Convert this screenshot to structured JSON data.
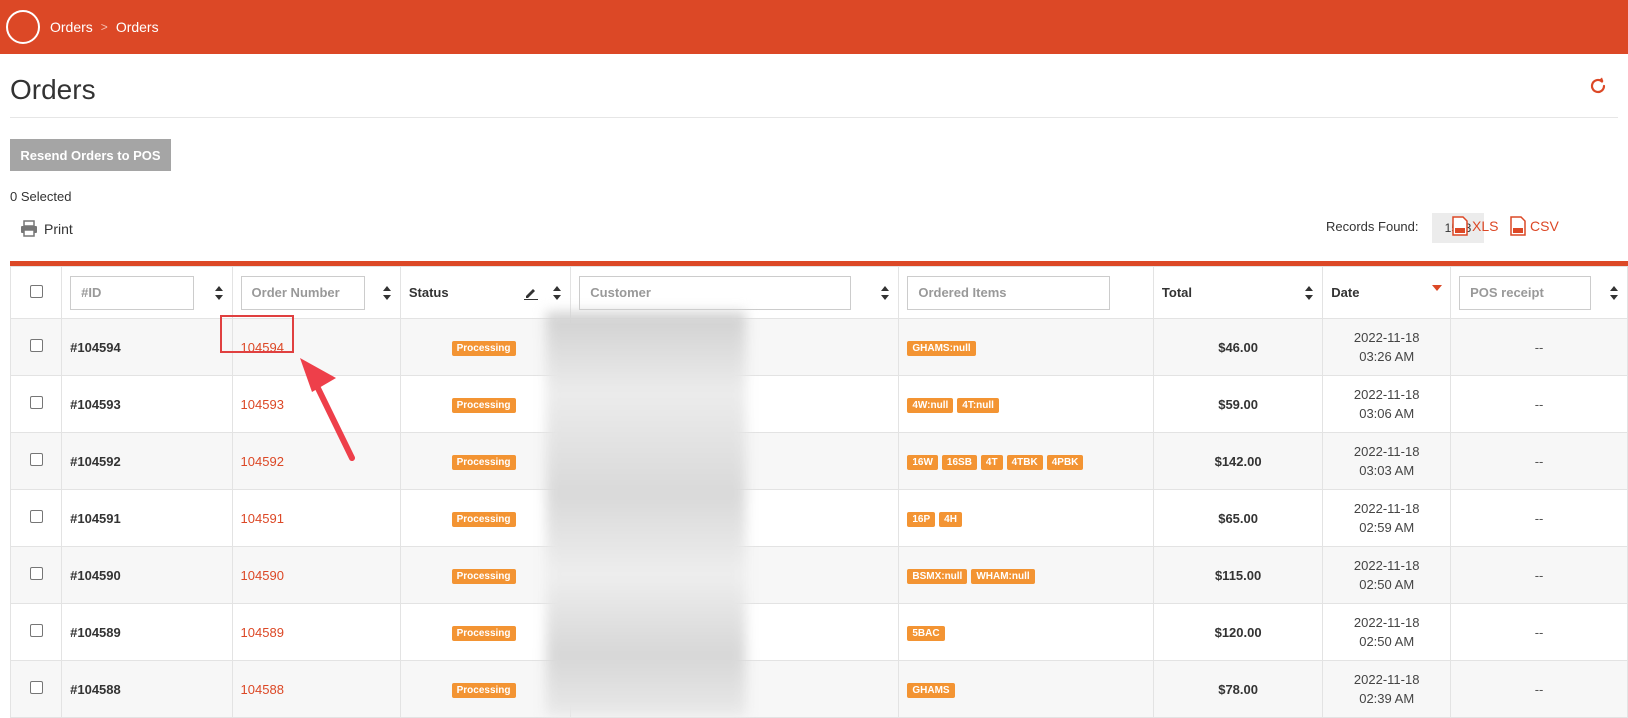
{
  "breadcrumb": {
    "items": [
      "Orders",
      "Orders"
    ],
    "separator": ">"
  },
  "page": {
    "title": "Orders"
  },
  "actions": {
    "resend_label": "Resend Orders to POS",
    "selected_text": "0 Selected",
    "print_label": "Print",
    "records_label": "Records Found:",
    "records_count": "1543",
    "xls_label": "XLS",
    "csv_label": "CSV"
  },
  "table": {
    "headers": {
      "id_placeholder": "#ID",
      "order_number_placeholder": "Order Number",
      "status": "Status",
      "customer_placeholder": "Customer",
      "ordered_items_placeholder": "Ordered Items",
      "total": "Total",
      "date": "Date",
      "pos_receipt_placeholder": "POS receipt"
    },
    "rows": [
      {
        "id": "#104594",
        "order_number": "104594",
        "status": "Processing",
        "items": [
          "GHAMS:null"
        ],
        "total": "$46.00",
        "date": "2022-11-18",
        "time": "03:26 AM",
        "pos": "--"
      },
      {
        "id": "#104593",
        "order_number": "104593",
        "status": "Processing",
        "items": [
          "4W:null",
          "4T:null"
        ],
        "total": "$59.00",
        "date": "2022-11-18",
        "time": "03:06 AM",
        "pos": "--"
      },
      {
        "id": "#104592",
        "order_number": "104592",
        "status": "Processing",
        "items": [
          "16W",
          "16SB",
          "4T",
          "4TBK",
          "4PBK"
        ],
        "total": "$142.00",
        "date": "2022-11-18",
        "time": "03:03 AM",
        "pos": "--"
      },
      {
        "id": "#104591",
        "order_number": "104591",
        "status": "Processing",
        "items": [
          "16P",
          "4H"
        ],
        "total": "$65.00",
        "date": "2022-11-18",
        "time": "02:59 AM",
        "pos": "--"
      },
      {
        "id": "#104590",
        "order_number": "104590",
        "status": "Processing",
        "items": [
          "BSMX:null",
          "WHAM:null"
        ],
        "total": "$115.00",
        "date": "2022-11-18",
        "time": "02:50 AM",
        "pos": "--"
      },
      {
        "id": "#104589",
        "order_number": "104589",
        "status": "Processing",
        "items": [
          "5BAC"
        ],
        "total": "$120.00",
        "date": "2022-11-18",
        "time": "02:50 AM",
        "pos": "--"
      },
      {
        "id": "#104588",
        "order_number": "104588",
        "status": "Processing",
        "items": [
          "GHAMS"
        ],
        "total": "$78.00",
        "date": "2022-11-18",
        "time": "02:39 AM",
        "pos": "--"
      }
    ]
  },
  "colors": {
    "brand": "#dc4826",
    "badge": "#f39433",
    "highlight": "#e04040"
  }
}
